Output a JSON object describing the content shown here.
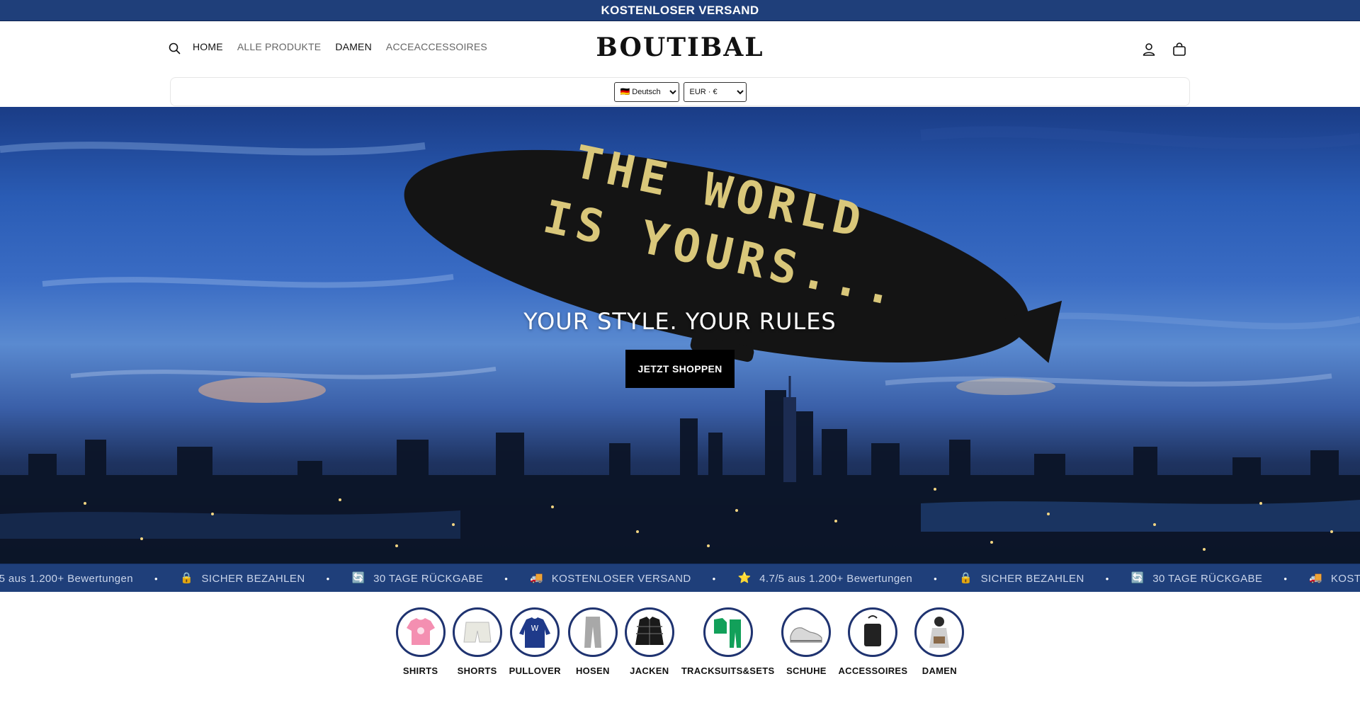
{
  "announcement": {
    "text": "KOSTENLOSER VERSAND",
    "bg": "#1f3f7a"
  },
  "header": {
    "logo": "BOUTIBAL",
    "nav": [
      {
        "label": "HOME",
        "strong": true
      },
      {
        "label": "ALLE PRODUKTE",
        "strong": false
      },
      {
        "label": "DAMEN",
        "strong": true
      },
      {
        "label": "ACCEACCESSOIRES",
        "strong": false
      }
    ],
    "icons": {
      "search": "search-icon",
      "account": "user-icon",
      "cart": "bag-icon"
    }
  },
  "locale": {
    "language": "🇩🇪 Deutsch",
    "currency": "EUR · €"
  },
  "hero": {
    "tagline": "YOUR STYLE. YOUR RULES",
    "cta": "JETZT SHOPPEN",
    "blimp_line1": "THE WORLD",
    "blimp_line2": "IS YOURS..."
  },
  "ticker": {
    "items": [
      {
        "emoji": "⭐",
        "text": "4.7/5 aus 1.200+ Bewertungen"
      },
      {
        "emoji": "🔒",
        "text": "SICHER BEZAHLEN"
      },
      {
        "emoji": "🔄",
        "text": "30 TAGE RÜCKGABE"
      },
      {
        "emoji": "🚚",
        "text": "KOSTENLOSER VERSAND"
      },
      {
        "emoji": "⭐",
        "text": "4.7/5 aus 1.200+ Bewertungen"
      },
      {
        "emoji": "🔒",
        "text": "SICHER BEZAHLEN"
      },
      {
        "emoji": "🔄",
        "text": "30 TAGE RÜCKGABE"
      },
      {
        "emoji": "🚚",
        "text": "KOSTENLOSER VERSAND"
      },
      {
        "emoji": "⭐",
        "text": "4.7/5 aus 1.200+ Bewertungen"
      }
    ]
  },
  "categories": [
    {
      "label": "SHIRTS",
      "icon": "tshirt-icon",
      "color": "#f48fb1"
    },
    {
      "label": "SHORTS",
      "icon": "shorts-icon",
      "color": "#e8e8e0"
    },
    {
      "label": "PULLOVER",
      "icon": "sweater-icon",
      "color": "#1f3a8a"
    },
    {
      "label": "HOSEN",
      "icon": "pants-icon",
      "color": "#a8a8a8"
    },
    {
      "label": "JACKEN",
      "icon": "jacket-icon",
      "color": "#1a1a1a"
    },
    {
      "label": "TRACKSUITS&SETS",
      "icon": "tracksuit-icon",
      "color": "#12a05a"
    },
    {
      "label": "SCHUHE",
      "icon": "sneaker-icon",
      "color": "#d8d8d8"
    },
    {
      "label": "ACCESSOIRES",
      "icon": "bag-accessory-icon",
      "color": "#222222"
    },
    {
      "label": "DAMEN",
      "icon": "women-icon",
      "color": "#2a2a2a"
    }
  ]
}
